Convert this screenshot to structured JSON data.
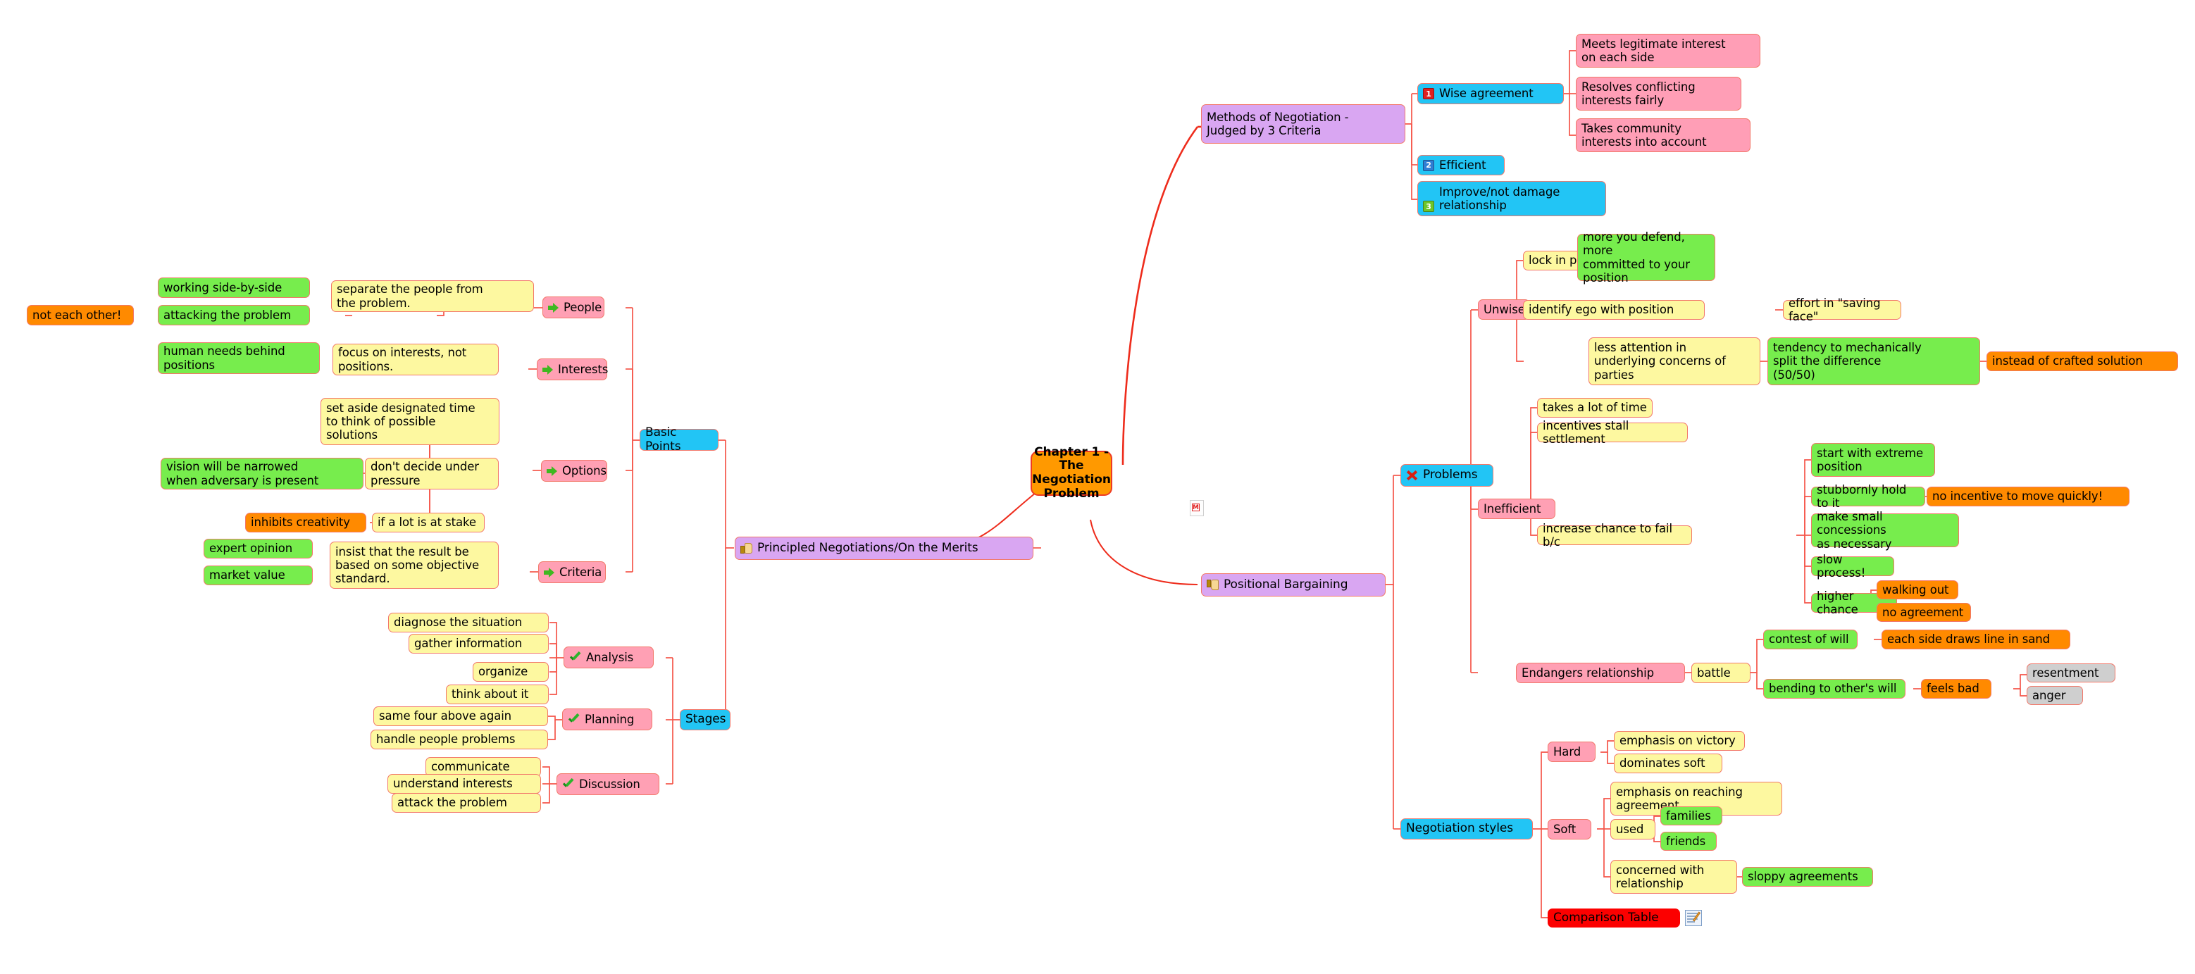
{
  "map": {
    "title": "Chapter 1 - The Negotiation Problem",
    "root_label": "Chapter 1 - The\nNegotiation\nProblem",
    "colors": {
      "line": "#f5564a",
      "root_fill": "#ff9900",
      "purple": "#d9a6f2",
      "cyan": "#22c5f5",
      "pink": "#ffa0b4",
      "yellow": "#fdf8a0",
      "green": "#77ed4d",
      "orange": "#ff8a00",
      "grey": "#cfcfcf",
      "red": "#fc0000"
    }
  },
  "root": {
    "label": "Chapter 1 - The\nNegotiation\nProblem",
    "note_icon": "note-m-icon"
  },
  "branches": {
    "methods": {
      "label": "Methods of Negotiation -\nJudged by 3 Criteria",
      "criteria": [
        {
          "num": "1",
          "label": "Wise agreement",
          "children": [
            "Meets legitimate interest\non each side",
            "Resolves conflicting\ninterests fairly",
            "Takes community\ninterests into account"
          ]
        },
        {
          "num": "2",
          "label": "Efficient",
          "children": []
        },
        {
          "num": "3",
          "label": "Improve/not damage\nrelationship",
          "children": []
        }
      ]
    },
    "principled": {
      "label": "Principled Negotiations/On the Merits",
      "icon": "thumbs-up-icon",
      "basic_points": {
        "label": "Basic Points",
        "items": [
          {
            "label": "People",
            "detail": "separate the people from\nthe problem.",
            "subs": [
              {
                "label": "working side-by-side",
                "tail": null
              },
              {
                "label": "attacking the problem",
                "tail": "not each other!"
              }
            ]
          },
          {
            "label": "Interests",
            "detail": "focus on interests, not\npositions.",
            "subs": [
              {
                "label": "human needs behind\npositions",
                "tail": null
              }
            ]
          },
          {
            "label": "Options",
            "detail": null,
            "details": [
              {
                "label": "set aside designated time\nto think of possible\nsolutions",
                "subs": []
              },
              {
                "label": "don't decide under\npressure",
                "subs": [
                  {
                    "label": "vision will be narrowed\nwhen adversary is present"
                  }
                ]
              },
              {
                "label": "if a lot is at stake",
                "subs": [
                  {
                    "label": "inhibits creativity"
                  }
                ]
              }
            ]
          },
          {
            "label": "Criteria",
            "detail": "insist that the result be\nbased on some objective\nstandard.",
            "subs": [
              {
                "label": "expert opinion",
                "tail": null
              },
              {
                "label": "market value",
                "tail": null
              }
            ]
          }
        ]
      },
      "stages": {
        "label": "Stages",
        "items": [
          {
            "label": "Analysis",
            "children": [
              "diagnose the situation",
              "gather information",
              "organize",
              "think about it"
            ]
          },
          {
            "label": "Planning",
            "children": [
              "same four above again",
              "handle people problems"
            ]
          },
          {
            "label": "Discussion",
            "children": [
              "communicate",
              "understand interests",
              "attack the problem"
            ]
          }
        ]
      }
    },
    "positional": {
      "label": "Positional Bargaining",
      "icon": "thumbs-down-icon",
      "problems": {
        "label": "Problems",
        "icon": "red-x-icon",
        "groups": [
          {
            "label": "Unwise",
            "rows": [
              {
                "label": "lock in positions",
                "next": "more you defend, more\ncommitted to your\nposition",
                "next2": null
              },
              {
                "label": "identify ego with position",
                "next": "effort in \"saving face\"",
                "next2": null
              },
              {
                "label": "less attention in\nunderlying concerns of\nparties",
                "next": "tendency to mechanically\nsplit the difference\n(50/50)",
                "next2": "instead of crafted solution"
              }
            ]
          },
          {
            "label": "Inefficient",
            "rows": [
              {
                "label": "takes a lot of time"
              },
              {
                "label": "incentives stall settlement"
              },
              {
                "label": "increase chance to fail b/c",
                "children": [
                  {
                    "label": "start with extreme\nposition",
                    "tail": null
                  },
                  {
                    "label": "stubbornly hold to it",
                    "tail": "no incentive to move quickly!"
                  },
                  {
                    "label": "make small concessions\nas necessary",
                    "tail": null
                  },
                  {
                    "label": "slow process!",
                    "tail": null
                  },
                  {
                    "label": "higher chance",
                    "tails": [
                      "walking out",
                      "no agreement"
                    ]
                  }
                ]
              }
            ]
          },
          {
            "label": "Endangers relationship",
            "battle": "battle",
            "rows": [
              {
                "label": "contest of will",
                "tail": "each side draws line in sand",
                "tails2": []
              },
              {
                "label": "bending to other's will",
                "tail": "feels bad",
                "tails2": [
                  "resentment",
                  "anger"
                ]
              }
            ]
          }
        ]
      },
      "styles": {
        "label": "Negotiation styles",
        "items": [
          {
            "label": "Hard",
            "children": [
              {
                "label": "emphasis on victory"
              },
              {
                "label": "dominates soft"
              }
            ]
          },
          {
            "label": "Soft",
            "children": [
              {
                "label": "emphasis on reaching\nagreement"
              },
              {
                "label": "used",
                "subs": [
                  "families",
                  "friends"
                ]
              },
              {
                "label": "concerned with\nrelationship",
                "tail": "sloppy agreements"
              }
            ]
          }
        ],
        "comparison_table": {
          "label": "Comparison Table",
          "icon": "table-edit-icon"
        }
      }
    }
  }
}
